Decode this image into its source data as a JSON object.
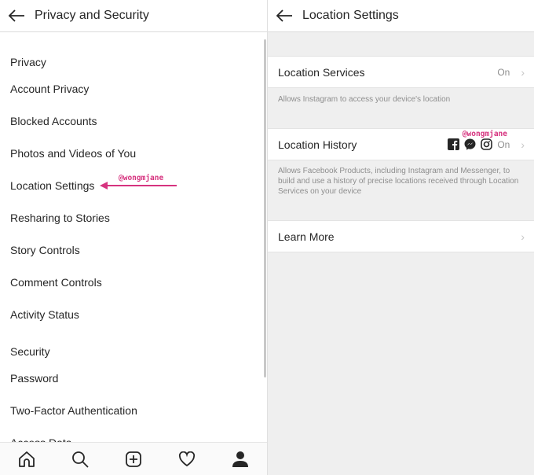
{
  "left": {
    "title": "Privacy and Security",
    "sections": [
      {
        "header": "Privacy",
        "items": [
          "Account Privacy",
          "Blocked Accounts",
          "Photos and Videos of You",
          "Location Settings",
          "Resharing to Stories",
          "Story Controls",
          "Comment Controls",
          "Activity Status"
        ]
      },
      {
        "header": "Security",
        "items": [
          "Password",
          "Two-Factor Authentication",
          "Access Data"
        ]
      }
    ],
    "watermark": "@wongmjane",
    "nav": [
      "home-icon",
      "search-icon",
      "add-post-icon",
      "heart-icon",
      "profile-icon"
    ]
  },
  "right": {
    "title": "Location Settings",
    "location_services": {
      "label": "Location Services",
      "value": "On",
      "description": "Allows Instagram to access your device's location"
    },
    "location_history": {
      "label": "Location History",
      "value": "On",
      "watermark": "@wongmjane",
      "description": "Allows Facebook Products, including Instagram and Messenger, to build and use a history of precise locations received through Location Services on your device",
      "icons": [
        "facebook-icon",
        "messenger-icon",
        "instagram-icon"
      ]
    },
    "learn_more": {
      "label": "Learn More"
    }
  },
  "colors": {
    "watermark": "#d6337f",
    "background": "#efefef"
  }
}
